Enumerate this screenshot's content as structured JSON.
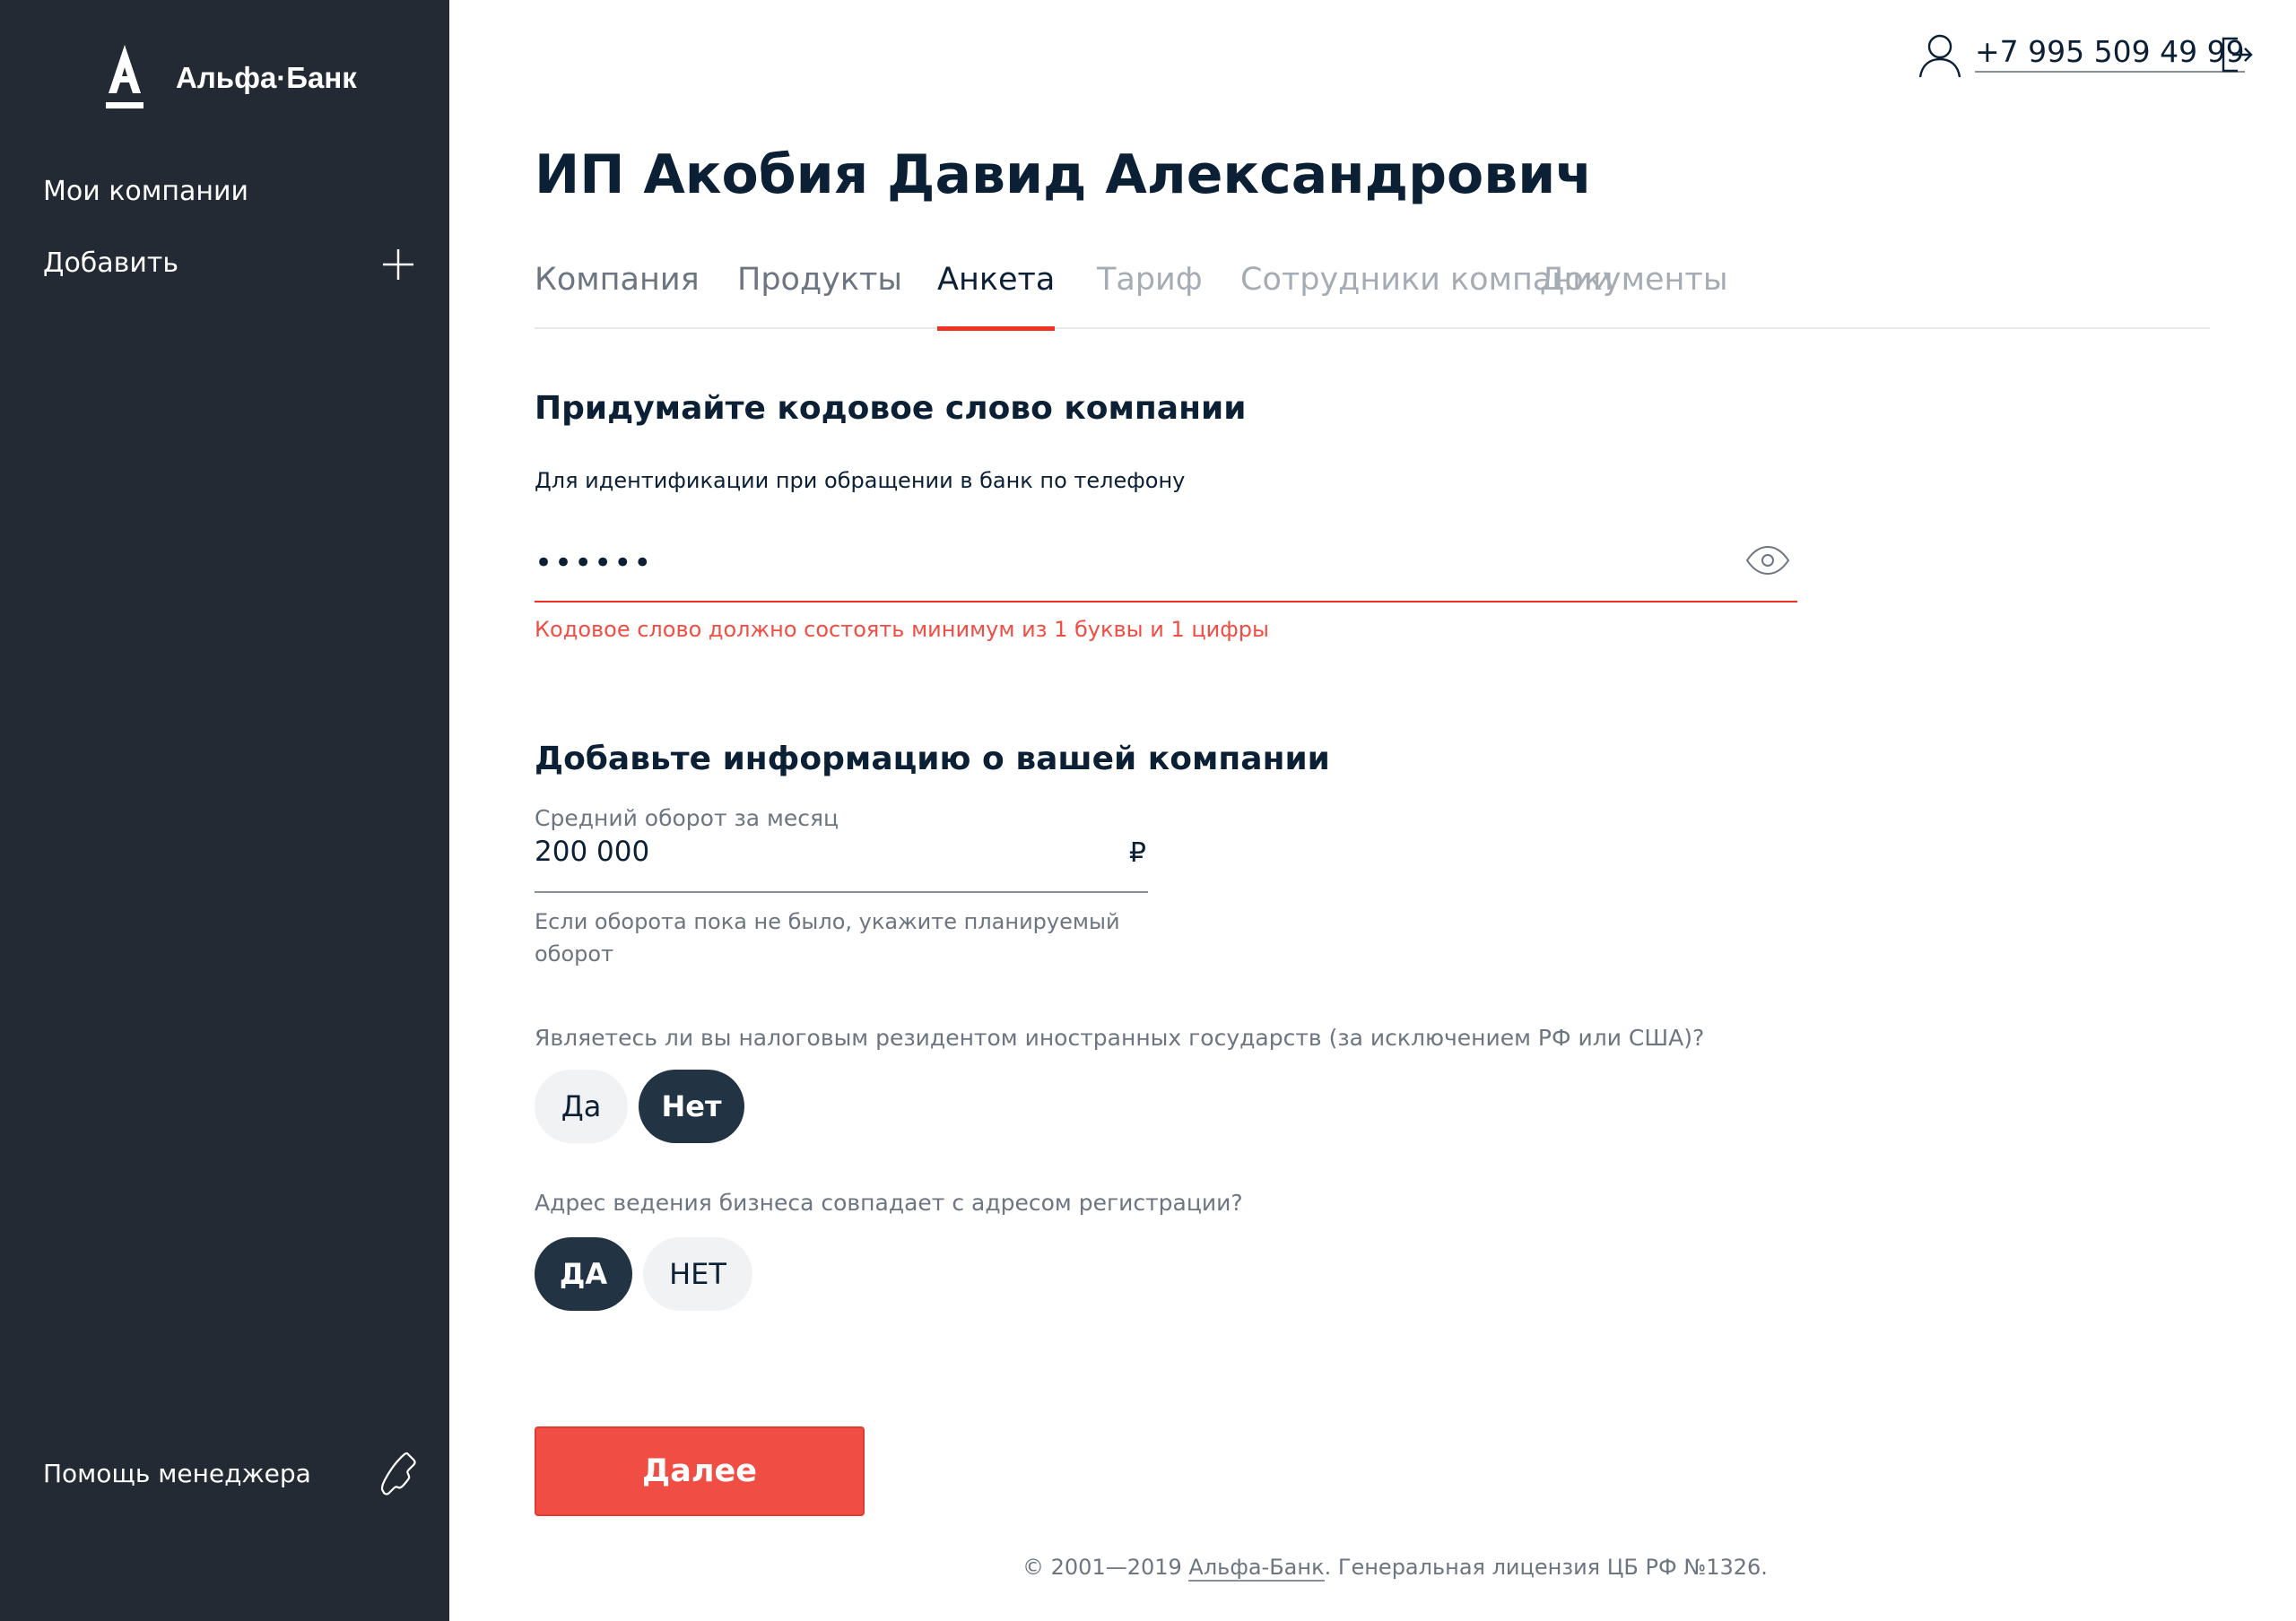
{
  "brand": {
    "name": "Альфа·Банк"
  },
  "sidebar": {
    "items": [
      {
        "label": "Мои компании"
      },
      {
        "label": "Добавить"
      }
    ],
    "help_label": "Помощь менеджера"
  },
  "header": {
    "phone": "+7 995 509 49 99"
  },
  "page": {
    "title": "ИП Акобия Давид Александрович"
  },
  "tabs": [
    {
      "label": "Компания"
    },
    {
      "label": "Продукты"
    },
    {
      "label": "Анкета",
      "active": true
    },
    {
      "label": "Тариф"
    },
    {
      "label": "Сотрудники компании"
    },
    {
      "label": "Документы"
    }
  ],
  "codeword": {
    "heading": "Придумайте кодовое слово компании",
    "hint": "Для идентификации при обращении в банк по телефону",
    "value": "••••••",
    "error": "Кодовое слово должно состоять минимум из 1 буквы и 1 цифры"
  },
  "company_info": {
    "heading": "Добавьте информацию о вашей компании",
    "turnover_label": "Средний оборот за месяц",
    "turnover_value": "200 000",
    "currency": "₽",
    "turnover_hint": "Если оборота пока не было, укажите планируемый оборот"
  },
  "tax_resident": {
    "question": "Являетесь ли вы налоговым резидентом иностранных государств (за исключением РФ или США)?",
    "options": [
      "Да",
      "Нет"
    ],
    "selected": "Нет"
  },
  "address_match": {
    "question": "Адрес ведения бизнеса совпадает с адресом регистрации?",
    "options": [
      "ДА",
      "НЕТ"
    ],
    "selected": "ДА"
  },
  "actions": {
    "next_label": "Далее"
  },
  "footer": {
    "prefix": "© 2001—2019 ",
    "link": "Альфа-Банк",
    "suffix": ". Генеральная лицензия ЦБ РФ №1326."
  },
  "colors": {
    "sidebar_bg": "#232a33",
    "accent_red": "#ef3124",
    "button_red": "#f04e45",
    "toggle_selected": "#223344",
    "text_dark": "#0b1f35",
    "text_muted": "#6c7580"
  }
}
